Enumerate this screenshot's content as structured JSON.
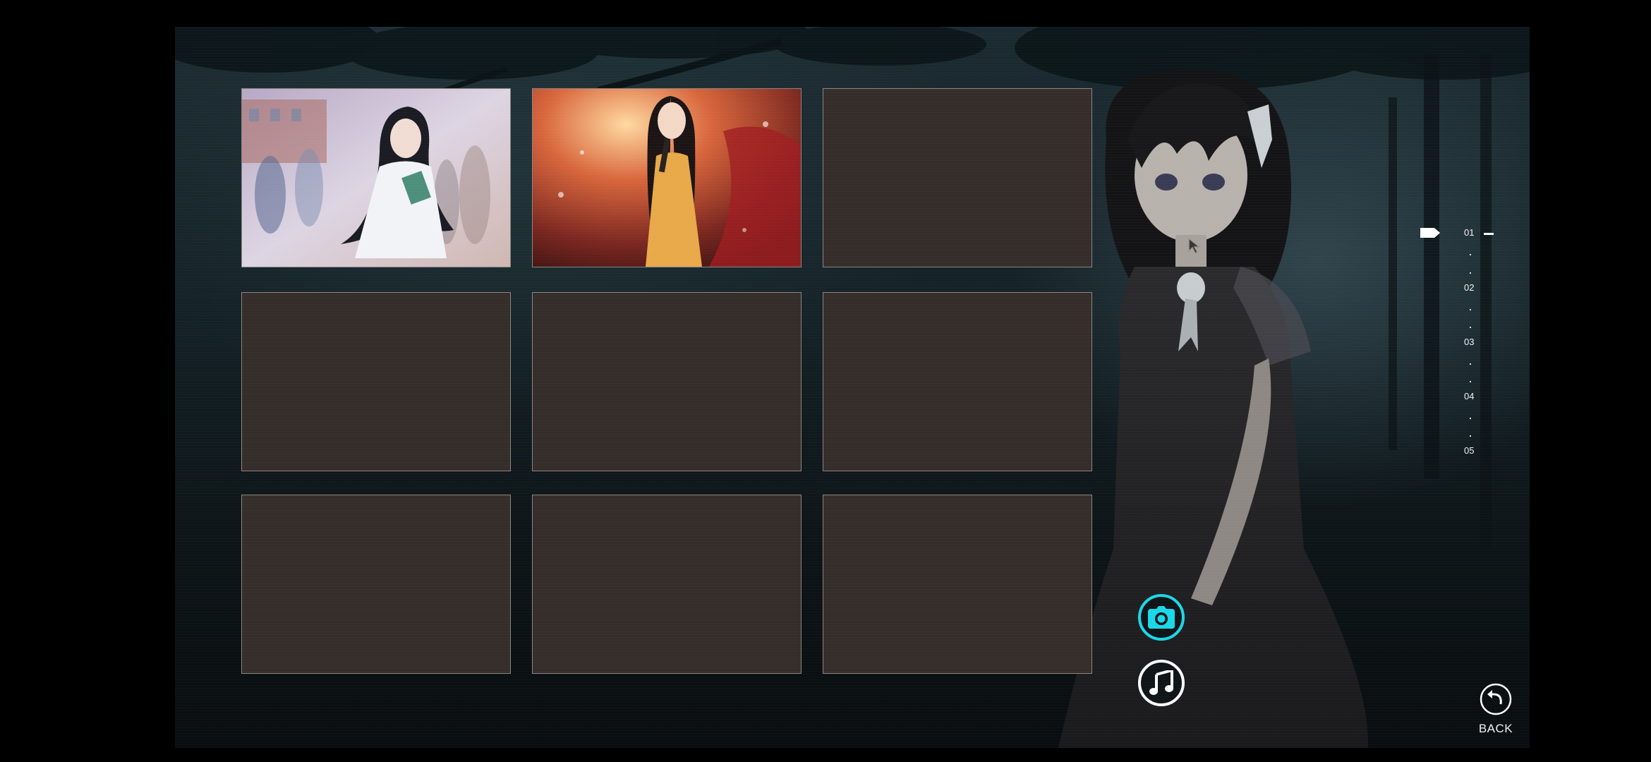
{
  "gallery": {
    "thumbnails": [
      {
        "state": "unlocked",
        "scene": "girl-white-dress-school"
      },
      {
        "state": "unlocked",
        "scene": "girl-yellow-dress-stage"
      },
      {
        "state": "locked"
      },
      {
        "state": "locked"
      },
      {
        "state": "locked"
      },
      {
        "state": "locked"
      },
      {
        "state": "locked"
      },
      {
        "state": "locked"
      },
      {
        "state": "locked"
      }
    ]
  },
  "pages": {
    "current": "01",
    "items": [
      "01",
      "02",
      "03",
      "04",
      "05"
    ]
  },
  "side_buttons": {
    "cg": {
      "icon": "camera-icon",
      "active": true
    },
    "music": {
      "icon": "music-note-icon",
      "active": false
    }
  },
  "back": {
    "label": "BACK",
    "icon": "back-arrow-icon"
  },
  "colors": {
    "accent": "#1ad8e8",
    "locked_slot": "#352d2a",
    "slot_border": "#8c8480"
  }
}
